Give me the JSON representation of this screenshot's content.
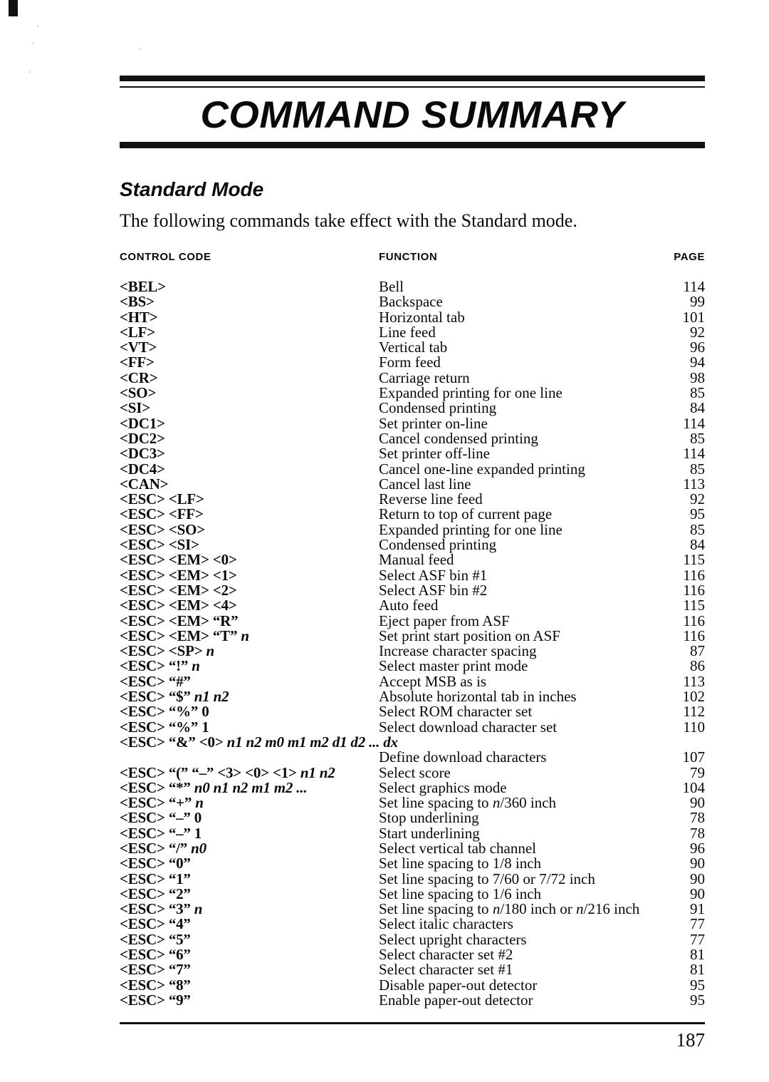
{
  "document": {
    "chapter_title": "COMMAND SUMMARY",
    "section_heading": "Standard Mode",
    "section_intro": "The following commands take effect with the Standard mode.",
    "page_number": "187"
  },
  "table": {
    "headers": {
      "control_code": "CONTROL CODE",
      "function": "FUNCTION",
      "page": "PAGE"
    },
    "rows": [
      {
        "code": "<BEL>",
        "function": "Bell",
        "page": "114"
      },
      {
        "code": "<BS>",
        "function": "Backspace",
        "page": "99"
      },
      {
        "code": "<HT>",
        "function": "Horizontal tab",
        "page": "101"
      },
      {
        "code": "<LF>",
        "function": "Line feed",
        "page": "92"
      },
      {
        "code": "<VT>",
        "function": "Vertical tab",
        "page": "96"
      },
      {
        "code": "<FF>",
        "function": "Form feed",
        "page": "94"
      },
      {
        "code": "<CR>",
        "function": "Carriage return",
        "page": "98"
      },
      {
        "code": "<SO>",
        "function": "Expanded printing for one line",
        "page": "85"
      },
      {
        "code": "<SI>",
        "function": "Condensed printing",
        "page": "84"
      },
      {
        "code": "<DC1>",
        "function": "Set printer on-line",
        "page": "114"
      },
      {
        "code": "<DC2>",
        "function": "Cancel condensed printing",
        "page": "85"
      },
      {
        "code": "<DC3>",
        "function": "Set printer off-line",
        "page": "114"
      },
      {
        "code": "<DC4>",
        "function": "Cancel one-line expanded printing",
        "page": "85"
      },
      {
        "code": "<CAN>",
        "function": "Cancel last line",
        "page": "113"
      },
      {
        "code": "<ESC>  <LF>",
        "function": "Reverse line feed",
        "page": "92"
      },
      {
        "code": "<ESC>  <FF>",
        "function": "Return to top of current page",
        "page": "95"
      },
      {
        "code": "<ESC>  <SO>",
        "function": "Expanded printing for one line",
        "page": "85"
      },
      {
        "code": "<ESC>  <SI>",
        "function": "Condensed printing",
        "page": "84"
      },
      {
        "code": "<ESC>  <EM>  <0>",
        "function": "Manual feed",
        "page": "115"
      },
      {
        "code": "<ESC>  <EM>  <1>",
        "function": "Select ASF bin #1",
        "page": "116"
      },
      {
        "code": "<ESC>  <EM>  <2>",
        "function": "Select ASF bin #2",
        "page": "116"
      },
      {
        "code": "<ESC>  <EM>  <4>",
        "function": "Auto feed",
        "page": "115"
      },
      {
        "code": "<ESC>  <EM>  “R”",
        "function": "Eject paper from ASF",
        "page": "116"
      },
      {
        "code": "<ESC>  <EM>  “T” ",
        "code_arg": "n",
        "function": "Set print start position on ASF",
        "page": "116"
      },
      {
        "code": "<ESC>  <SP>  ",
        "code_arg": "n",
        "function": "Increase character spacing",
        "page": "87"
      },
      {
        "code": "<ESC>  “!”  ",
        "code_arg": "n",
        "function": "Select master print mode",
        "page": "86"
      },
      {
        "code": "<ESC>  “#”",
        "function": "Accept MSB as is",
        "page": "113"
      },
      {
        "code": "<ESC>  “$”  ",
        "code_arg": "n1  n2",
        "function": "Absolute horizontal tab in inches",
        "page": "102"
      },
      {
        "code": "<ESC>  “%”  0",
        "function": "Select ROM character set",
        "page": "112"
      },
      {
        "code": "<ESC>  “%”  1",
        "function": "Select download character set",
        "page": "110"
      },
      {
        "code": "<ESC>  “&”  <0> ",
        "code_arg": "n1 n2 m0 m1 m2 d1 d2  ... dx",
        "function": "",
        "page": ""
      },
      {
        "code": "",
        "function": "Define download characters",
        "page": "107",
        "continuation": true
      },
      {
        "code": "<ESC>  “(”  “–”  <3>  <0>  <1> ",
        "code_arg": "n1  n2",
        "function": "Select score",
        "page": "79"
      },
      {
        "code": "<ESC>  “*”  ",
        "code_arg": "n0  n1  n2  m1  m2  ...",
        "function": "Select graphics mode",
        "page": "104"
      },
      {
        "code": "<ESC>  “+”  ",
        "code_arg": "n",
        "function": "Set line spacing to ",
        "function_arg": "n",
        "function_tail": "/360 inch",
        "page": "90"
      },
      {
        "code": "<ESC>  “–”  0",
        "function": "Stop underlining",
        "page": "78"
      },
      {
        "code": "<ESC>  “–”  1",
        "function": "Start underlining",
        "page": "78"
      },
      {
        "code": "<ESC>  “/”  ",
        "code_arg": "n0",
        "function": "Select vertical tab channel",
        "page": "96"
      },
      {
        "code": "<ESC>  “0”",
        "function": "Set line spacing to 1/8 inch",
        "page": "90"
      },
      {
        "code": "<ESC>  “1”",
        "function": "Set line spacing to 7/60 or 7/72 inch",
        "page": "90"
      },
      {
        "code": "<ESC>  “2”",
        "function": "Set line spacing to 1/6 inch",
        "page": "90"
      },
      {
        "code": "<ESC>  “3”  ",
        "code_arg": "n",
        "function": "Set line spacing to ",
        "function_arg": "n",
        "function_tail": "/180 inch or ",
        "function_arg2": "n",
        "function_tail2": "/216 inch",
        "page": "91"
      },
      {
        "code": "<ESC>  “4”",
        "function": "Select italic characters",
        "page": "77"
      },
      {
        "code": "<ESC>  “5”",
        "function": "Select upright characters",
        "page": "77"
      },
      {
        "code": "<ESC>  “6”",
        "function": "Select character set #2",
        "page": "81"
      },
      {
        "code": "<ESC>  “7”",
        "function": "Select character set #1",
        "page": "81"
      },
      {
        "code": "<ESC>  “8”",
        "function": "Disable paper-out detector",
        "page": "95"
      },
      {
        "code": "<ESC>  “9”",
        "function": "Enable paper-out detector",
        "page": "95"
      }
    ]
  }
}
